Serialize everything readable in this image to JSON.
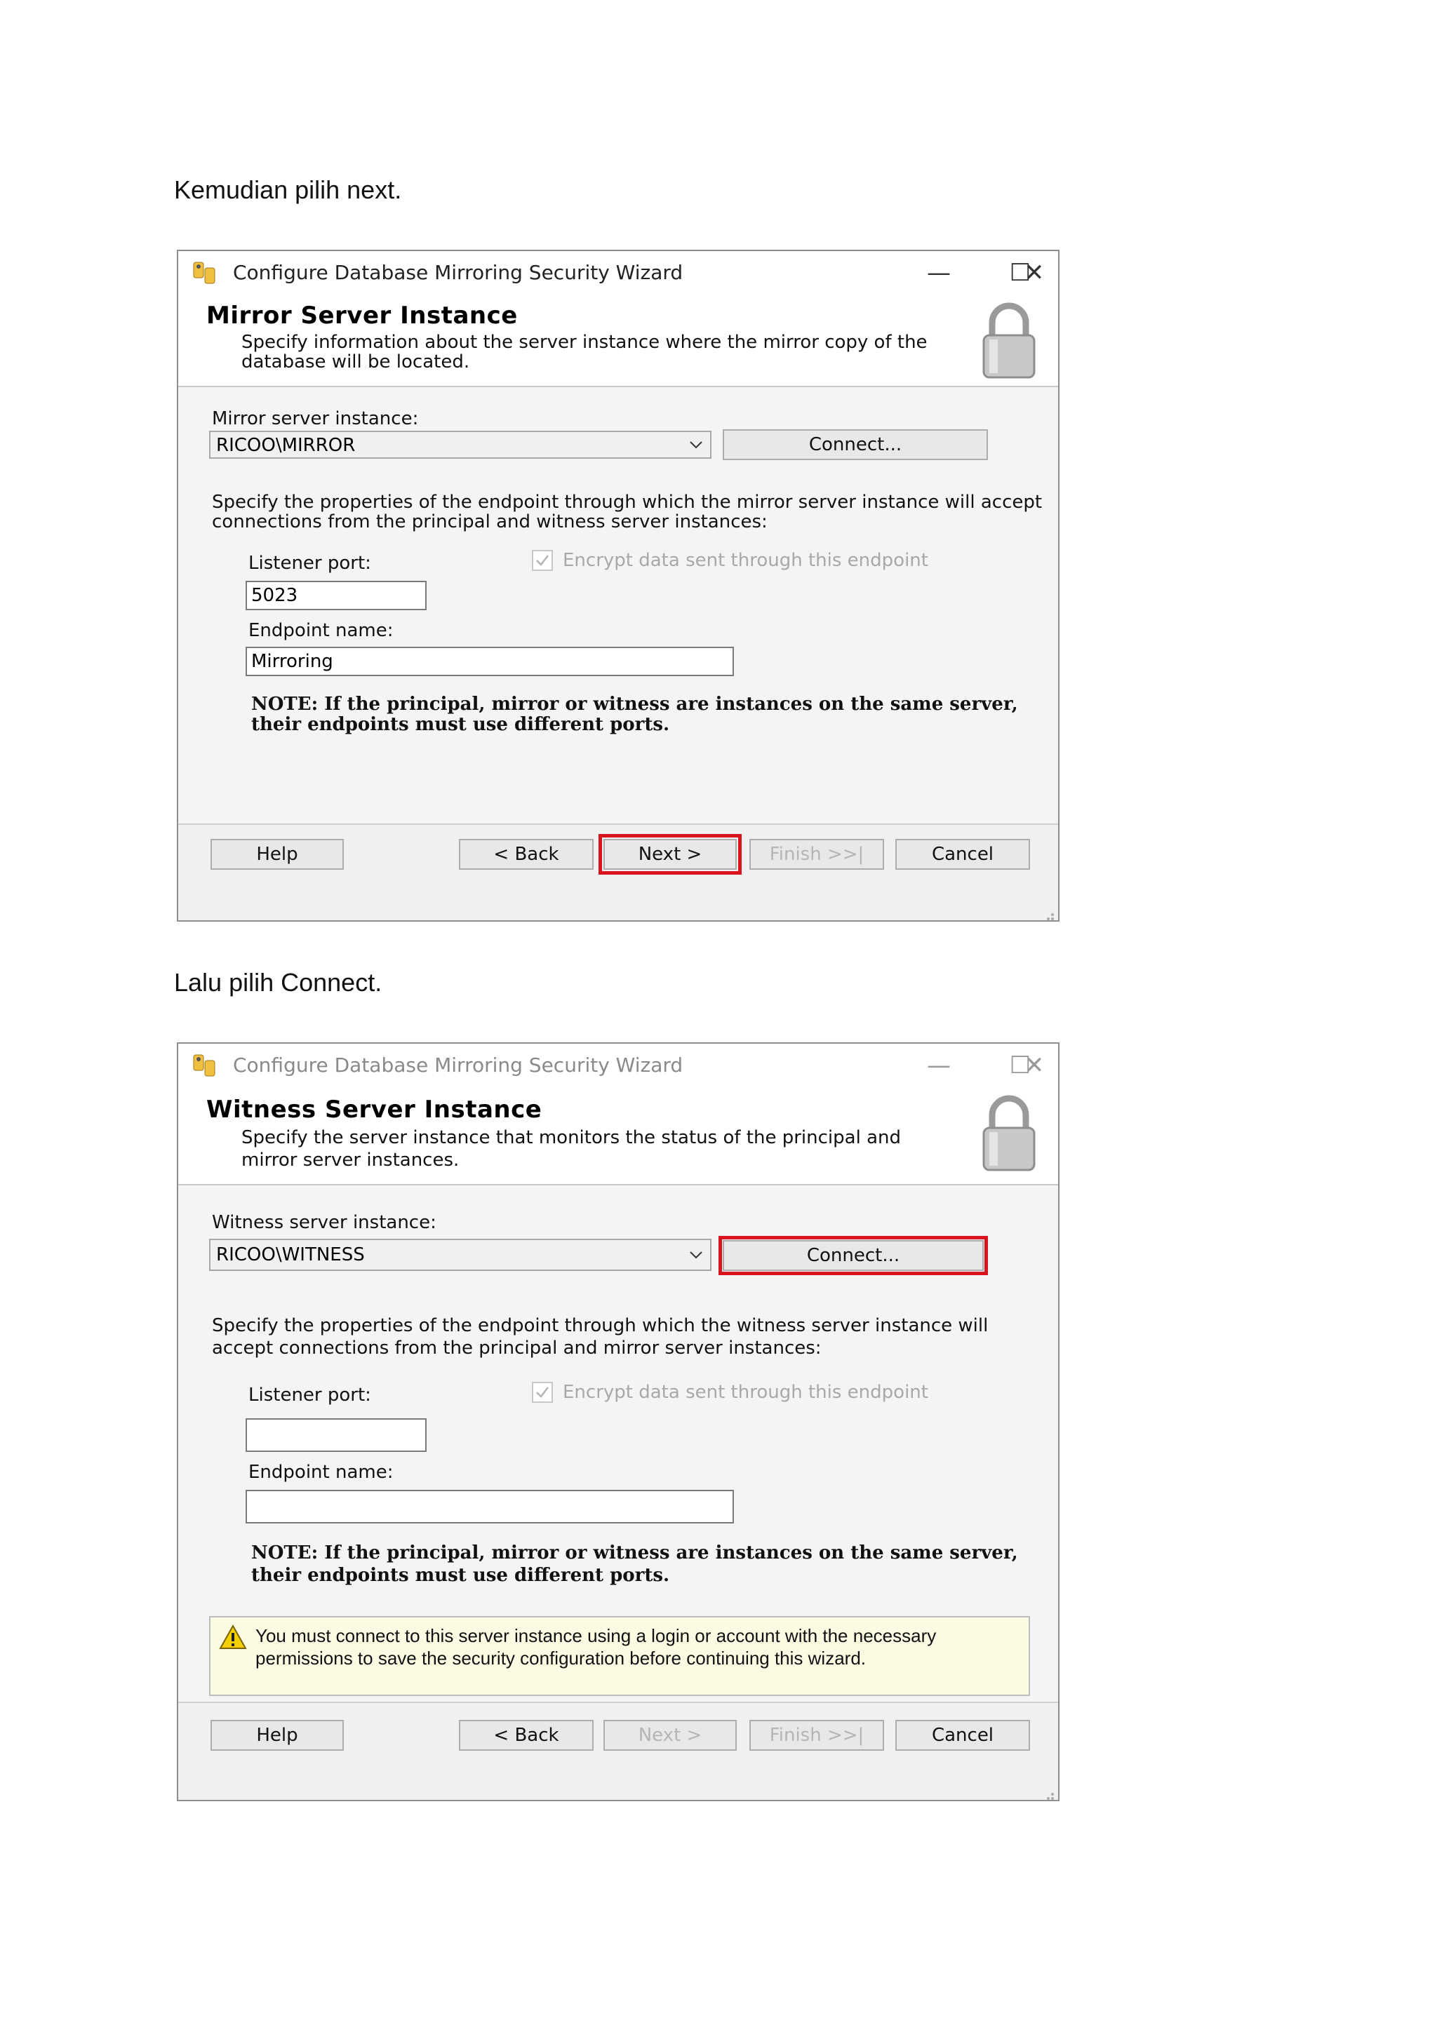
{
  "captions": {
    "first": "Kemudian pilih next.",
    "second": "Lalu pilih Connect."
  },
  "dialog1": {
    "window_title": "Configure Database Mirroring Security Wizard",
    "header_title": "Mirror Server Instance",
    "header_desc": "Specify information about the server instance where the mirror copy of the database will be located.",
    "server_label": "Mirror server instance:",
    "server_value": "RICOO\\MIRROR",
    "connect_label": "Connect...",
    "properties_text": "Specify the properties of the endpoint through which the mirror server instance will accept connections from the principal and witness server instances:",
    "listener_label": "Listener port:",
    "listener_value": "5023",
    "encrypt_label": "Encrypt data sent through this endpoint",
    "endpoint_label": "Endpoint name:",
    "endpoint_value": "Mirroring",
    "note_text": "NOTE: If the principal, mirror or witness are instances on the same server, their endpoints must use different ports.",
    "buttons": {
      "help": "Help",
      "back": "< Back",
      "next": "Next >",
      "finish": "Finish >>|",
      "cancel": "Cancel"
    },
    "highlight_color": "#d9141e"
  },
  "dialog2": {
    "window_title": "Configure Database Mirroring Security Wizard",
    "header_title": "Witness Server Instance",
    "header_desc": "Specify the server instance that monitors the status of the principal and mirror server instances.",
    "server_label": "Witness server instance:",
    "server_value": "RICOO\\WITNESS",
    "connect_label": "Connect...",
    "properties_text": "Specify the properties of the endpoint through which the witness server instance will accept connections from the principal and mirror server instances:",
    "listener_label": "Listener port:",
    "listener_value": "",
    "encrypt_label": "Encrypt data sent through this endpoint",
    "endpoint_label": "Endpoint name:",
    "endpoint_value": "",
    "note_text": "NOTE: If the principal, mirror or witness are instances on the same server, their endpoints must use different ports.",
    "warning_text": "You must connect to this server instance using a login or account with the necessary permissions to save the security configuration before continuing this wizard.",
    "buttons": {
      "help": "Help",
      "back": "< Back",
      "next": "Next >",
      "finish": "Finish >>|",
      "cancel": "Cancel"
    },
    "highlight_color": "#d9141e"
  }
}
